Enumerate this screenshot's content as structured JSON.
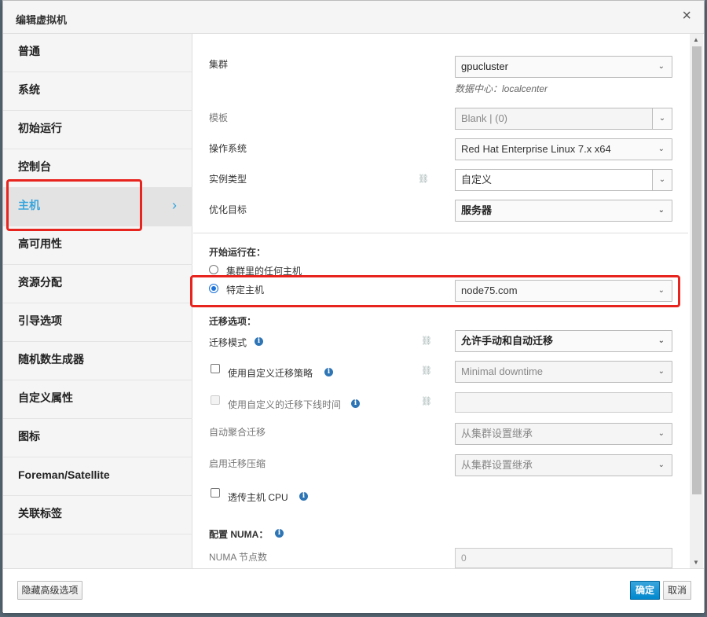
{
  "dialog": {
    "title": "编辑虚拟机",
    "close_glyph": "×"
  },
  "sidebar": {
    "items": [
      {
        "label": "普通"
      },
      {
        "label": "系统"
      },
      {
        "label": "初始运行"
      },
      {
        "label": "控制台"
      },
      {
        "label": "主机"
      },
      {
        "label": "高可用性"
      },
      {
        "label": "资源分配"
      },
      {
        "label": "引导选项"
      },
      {
        "label": "随机数生成器"
      },
      {
        "label": "自定义属性"
      },
      {
        "label": "图标"
      },
      {
        "label": "Foreman/Satellite"
      },
      {
        "label": "关联标签"
      }
    ],
    "active_index": 4,
    "chevron": "›"
  },
  "form": {
    "cluster": {
      "label": "集群",
      "value": "gpucluster",
      "sub": "数据中心：localcenter"
    },
    "template": {
      "label": "模板",
      "value": "Blank |  (0)"
    },
    "os": {
      "label": "操作系统",
      "value": "Red Hat Enterprise Linux 7.x x64"
    },
    "instance_type": {
      "label": "实例类型",
      "value": "自定义"
    },
    "optimize": {
      "label": "优化目标",
      "value": "服务器"
    },
    "start_on": {
      "title": "开始运行在：",
      "any_host": "集群里的任何主机",
      "specific_host": "特定主机",
      "host_value": "node75.com"
    },
    "migration": {
      "title": "迁移选项：",
      "mode_label": "迁移模式",
      "mode_value": "允许手动和自动迁移",
      "custom_policy_label": "使用自定义迁移策略",
      "custom_policy_value": "Minimal downtime",
      "custom_downtime_label": "使用自定义的迁移下线时间",
      "auto_converge_label": "自动聚合迁移",
      "auto_converge_value": "从集群设置继承",
      "compression_label": "启用迁移压缩",
      "compression_value": "从集群设置继承",
      "passthrough_label": "透传主机 CPU"
    },
    "numa": {
      "title": "配置 NUMA：",
      "nodes_label": "NUMA 节点数",
      "nodes_value": "0"
    }
  },
  "icons": {
    "caret": "⌄",
    "link": "⛓",
    "info": "i"
  },
  "footer": {
    "advanced_button": "隐藏高级选项",
    "ok_button": "确定",
    "cancel_button": "取消"
  },
  "colors": {
    "accent": "#39a5dc",
    "primary": "#0088ce",
    "highlight": "#e8241f"
  }
}
